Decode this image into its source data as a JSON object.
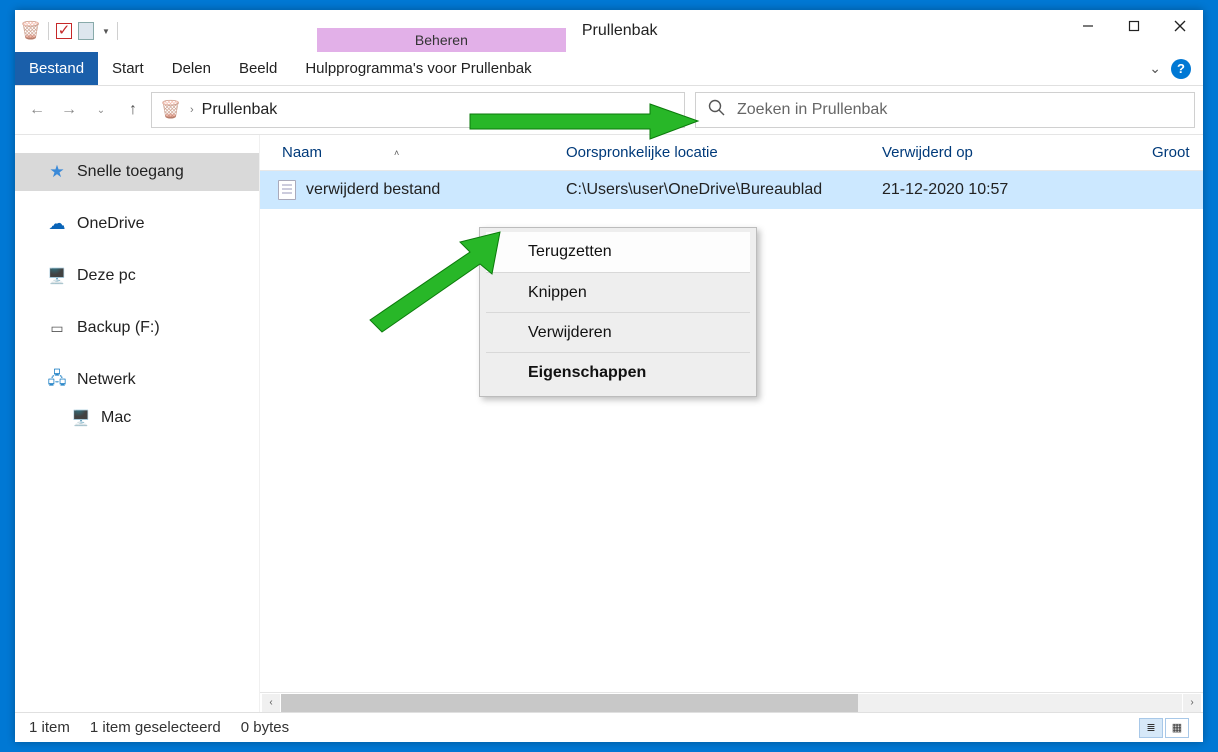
{
  "title": "Prullenbak",
  "ctx_tab_header": "Beheren",
  "ribbon": {
    "file": "Bestand",
    "tabs": [
      "Start",
      "Delen",
      "Beeld"
    ],
    "ctx_tab": "Hulpprogramma's voor Prullenbak"
  },
  "breadcrumb": {
    "item": "Prullenbak"
  },
  "search": {
    "placeholder": "Zoeken in Prullenbak"
  },
  "sidebar": {
    "quick": "Snelle toegang",
    "onedrive": "OneDrive",
    "thispc": "Deze pc",
    "backup": "Backup (F:)",
    "network": "Netwerk",
    "mac": "Mac"
  },
  "columns": {
    "name": "Naam",
    "location": "Oorspronkelijke locatie",
    "deleted": "Verwijderd op",
    "size": "Groot"
  },
  "row": {
    "name": "verwijderd bestand",
    "location": "C:\\Users\\user\\OneDrive\\Bureaublad",
    "deleted": "21-12-2020 10:57"
  },
  "context_menu": {
    "restore": "Terugzetten",
    "cut": "Knippen",
    "delete": "Verwijderen",
    "properties": "Eigenschappen"
  },
  "status": {
    "items": "1 item",
    "selected": "1 item geselecteerd",
    "bytes": "0 bytes"
  }
}
